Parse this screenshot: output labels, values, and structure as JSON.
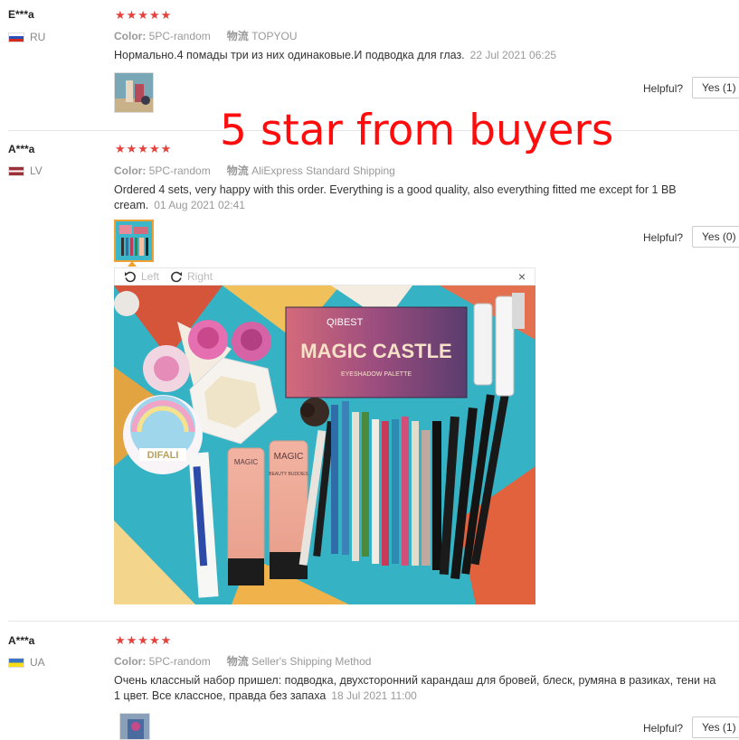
{
  "overlay": {
    "text": "5 star from buyers"
  },
  "labels": {
    "color": "Color:",
    "logistics": "物流",
    "helpful": "Helpful?"
  },
  "reviews": [
    {
      "name": "E***a",
      "country": "RU",
      "stars": "★★★★★",
      "color": "5PC-random",
      "shipping": "TOPYOU",
      "text": "Нормально.4 помады три из них одинаковые.И подводка для глаз.",
      "date": "22 Jul 2021 06:25",
      "yes": "Yes (1)"
    },
    {
      "name": "A***a",
      "country": "LV",
      "stars": "★★★★★",
      "color": "5PC-random",
      "shipping": "AliExpress Standard Shipping",
      "text": "Ordered 4 sets, very happy with this order. Everything is a good quality, also everything fitted me except for 1 BB cream.",
      "date": "01 Aug 2021 02:41",
      "yes": "Yes (0)"
    },
    {
      "name": "A***a",
      "country": "UA",
      "stars": "★★★★★",
      "color": "5PC-random",
      "shipping": "Seller's Shipping Method",
      "text": "Очень классный набор пришел: подводка, двухсторонний карандаш для бровей, блеск, румяна в разиках, тени на 1 цвет. Все классное, правда без запаха",
      "date": "18 Jul 2021 11:00",
      "yes": "Yes (1)"
    }
  ],
  "viewer": {
    "left": "Left",
    "right": "Right",
    "close": "×"
  },
  "photo": {
    "brand": "QIBEST",
    "title": "MAGIC CASTLE",
    "subtitle": "EYESHADOW PALETTE",
    "compact": "DIFALI",
    "tube_label": "MAGIC",
    "tube_sub": "BEAUTY BUDDIES"
  }
}
